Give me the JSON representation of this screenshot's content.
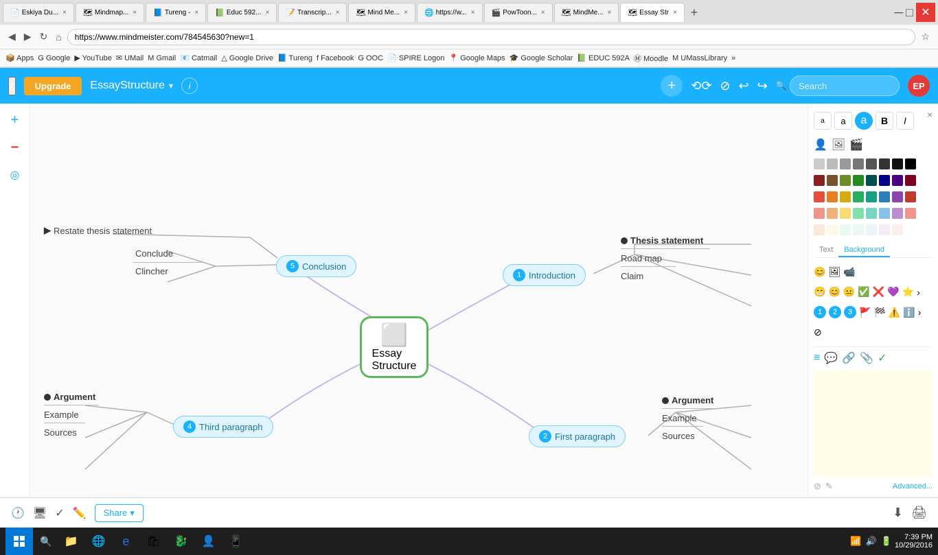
{
  "browser": {
    "tabs": [
      {
        "label": "Eskiya Du...",
        "icon": "📄",
        "active": false
      },
      {
        "label": "Mindmap...",
        "icon": "🗺",
        "active": false
      },
      {
        "label": "Tureng -",
        "icon": "📘",
        "active": false
      },
      {
        "label": "Educ 592...",
        "icon": "📗",
        "active": false
      },
      {
        "label": "Transcrip...",
        "icon": "📝",
        "active": false
      },
      {
        "label": "Mind Me...",
        "icon": "🗺",
        "active": false
      },
      {
        "label": "https://w...",
        "icon": "🌐",
        "active": false
      },
      {
        "label": "PowToon...",
        "icon": "🎬",
        "active": false
      },
      {
        "label": "MindMe...",
        "icon": "🗺",
        "active": false
      },
      {
        "label": "Essay Str",
        "icon": "🗺",
        "active": true
      }
    ],
    "url": "https://www.mindmeister.com/784545630?new=1",
    "bookmarks": [
      "Apps",
      "Google",
      "YouTube",
      "UMail",
      "Gmail",
      "Catmail",
      "Google Drive",
      "Tureng",
      "Facebook",
      "OOC",
      "SPIRE Logon",
      "Google Maps",
      "Google Scholar",
      "EDUC 592A",
      "Moodle",
      "UMassLibrary"
    ]
  },
  "app": {
    "title": "EssayStructure",
    "search_placeholder": "Search",
    "avatar": "EP",
    "upgrade_label": "Upgrade"
  },
  "mindmap": {
    "center": {
      "text_line1": "Essay",
      "text_line2": "Structure"
    },
    "nodes": {
      "conclusion": {
        "num": "5",
        "label": "Conclusion",
        "branches": [
          "Conclude",
          "Clincher"
        ],
        "extra": "Restate thesis statement"
      },
      "introduction": {
        "num": "1",
        "label": "Introduction",
        "branches": [
          "Thesis statement",
          "Road map",
          "Claim"
        ]
      },
      "first_paragraph": {
        "num": "2",
        "label": "First paragraph",
        "branches": [
          "Argument",
          "Example",
          "Sources"
        ]
      },
      "third_paragraph": {
        "num": "4",
        "label": "Third paragraph",
        "branches": [
          "Argument",
          "Example",
          "Sources"
        ]
      }
    }
  },
  "right_panel": {
    "text_tab": "Text",
    "background_tab": "Background",
    "colors_row1": [
      "#cccccc",
      "#bbbbbb",
      "#999999",
      "#777777",
      "#555555",
      "#333333",
      "#111111",
      "#000000"
    ],
    "colors_row2": [
      "#8b0000",
      "#7a5230",
      "#6b8e23",
      "#228b22",
      "#006400",
      "#00008b",
      "#4b0082",
      "#800080"
    ],
    "colors_row3": [
      "#e74c3c",
      "#e67e22",
      "#d4ac0d",
      "#27ae60",
      "#16a085",
      "#2980b9",
      "#8e44ad",
      "#c0392b"
    ],
    "colors_row4": [
      "#f1948a",
      "#f0b27a",
      "#f7dc6f",
      "#82e0aa",
      "#76d7c4",
      "#85c1e9",
      "#bb8fce",
      "#f1948a"
    ],
    "colors_row5": [
      "#fad7d7",
      "#fde8d8",
      "#fef9e7",
      "#eafaf1",
      "#e8f8f5",
      "#eaf4fb",
      "#f4ecf7",
      "#fdedec"
    ],
    "note_placeholder": "",
    "advanced_label": "Advanced...",
    "close_icon": "×"
  },
  "bottom_toolbar": {
    "share_label": "Share"
  },
  "taskbar": {
    "time": "7:39 PM",
    "date": "10/29/2016"
  }
}
